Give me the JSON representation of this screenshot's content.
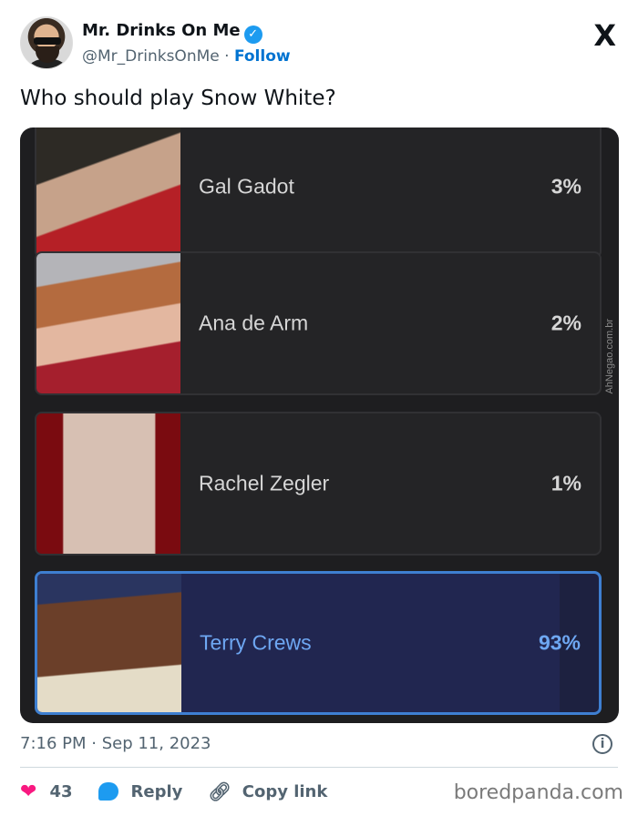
{
  "author": {
    "name": "Mr. Drinks On Me",
    "verified_icon": "verified-badge-icon",
    "handle": "@Mr_DrinksOnMe",
    "separator": "·",
    "follow_label": "Follow"
  },
  "brand_logo": "X",
  "tweet": {
    "text": "Who should play Snow White?"
  },
  "poll": {
    "options": [
      {
        "name": "Gal Gadot",
        "percent_label": "3%",
        "percent": 3
      },
      {
        "name": "Ana de Arm",
        "percent_label": "2%",
        "percent": 2
      },
      {
        "name": "Rachel Zegler",
        "percent_label": "1%",
        "percent": 1
      },
      {
        "name": "Terry Crews",
        "percent_label": "93%",
        "percent": 93,
        "winner": true
      }
    ],
    "watermark": "AhNegao.com.br"
  },
  "footer": {
    "timestamp": "7:16 PM · Sep 11, 2023",
    "likes": "43",
    "reply_label": "Reply",
    "copy_link_label": "Copy link",
    "source": "boredpanda.com"
  },
  "colors": {
    "accent": "#1d9bf0",
    "like": "#f91880",
    "winner_border": "#3e7fd1",
    "winner_text": "#6ea7f2"
  }
}
